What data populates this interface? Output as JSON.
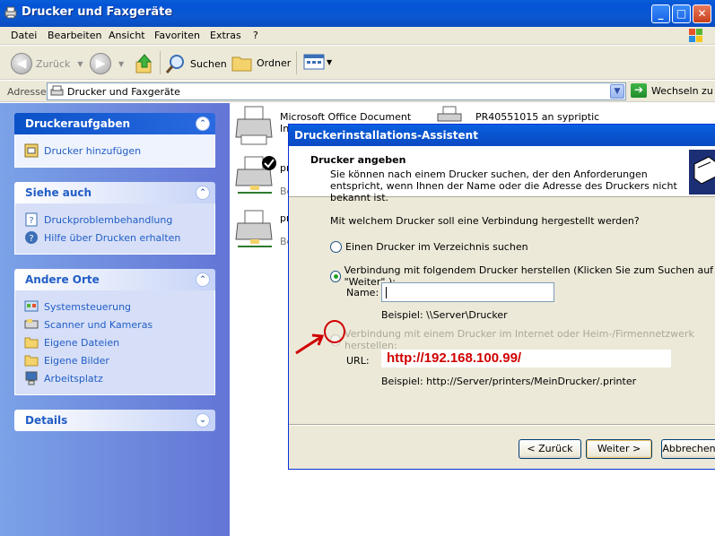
{
  "window": {
    "title": "Drucker und Faxgeräte"
  },
  "menu": [
    "Datei",
    "Bearbeiten",
    "Ansicht",
    "Favoriten",
    "Extras",
    "?"
  ],
  "toolbar": {
    "back_label": "Zurück",
    "search_label": "Suchen",
    "folders_label": "Ordner"
  },
  "address": {
    "label": "Adresse",
    "value": "Drucker und Faxgeräte",
    "go_label": "Wechseln zu"
  },
  "tasks": [
    {
      "title": "Druckeraufgaben",
      "links": [
        {
          "label": "Drucker hinzufügen",
          "icon": "add-printer-icon"
        }
      ]
    },
    {
      "title": "Siehe auch",
      "links": [
        {
          "label": "Druckproblembehandlung",
          "icon": "help-page-icon"
        },
        {
          "label": "Hilfe über Drucken erhalten",
          "icon": "help-icon"
        }
      ]
    },
    {
      "title": "Andere Orte",
      "links": [
        {
          "label": "Systemsteuerung",
          "icon": "control-panel-icon"
        },
        {
          "label": "Scanner und Kameras",
          "icon": "scanner-icon"
        },
        {
          "label": "Eigene Dateien",
          "icon": "folder-icon"
        },
        {
          "label": "Eigene Bilder",
          "icon": "folder-icon"
        },
        {
          "label": "Arbeitsplatz",
          "icon": "computer-icon"
        }
      ]
    },
    {
      "title": "Details",
      "links": []
    }
  ],
  "printers": [
    {
      "line1": "Microsoft Office Document",
      "line2": "In"
    },
    {
      "line1": "pr",
      "line2": "Be"
    },
    {
      "line1": "pr",
      "line2": "Be"
    },
    {
      "line1": "PR40551015 an sypriptic"
    }
  ],
  "wizard": {
    "title": "Druckerinstallations-Assistent",
    "header_title": "Drucker angeben",
    "header_desc": "Sie können nach einem Drucker suchen, der den Anforderungen entspricht, wenn Ihnen der Name oder die Adresse des Druckers nicht bekannt ist.",
    "question": "Mit welchem Drucker soll eine Verbindung hergestellt werden?",
    "option1": "Einen Drucker im Verzeichnis suchen",
    "option2": "Verbindung mit folgendem Drucker herstellen (Klicken Sie zum Suchen auf \"Weiter\".):",
    "name_label": "Name:",
    "name_value": "",
    "name_example": "Beispiel: \\\\Server\\Drucker",
    "option3": "Verbindung mit einem Drucker im Internet oder Heim-/Firmennetzwerk herstellen:",
    "url_label": "URL:",
    "url_value": "http://192.168.100.99/",
    "url_example": "Beispiel: http://Server/printers/MeinDrucker/.printer",
    "back_button": "< Zurück",
    "next_button": "Weiter >",
    "cancel_button": "Abbrechen"
  },
  "colors": {
    "annotation": "#d00000"
  }
}
